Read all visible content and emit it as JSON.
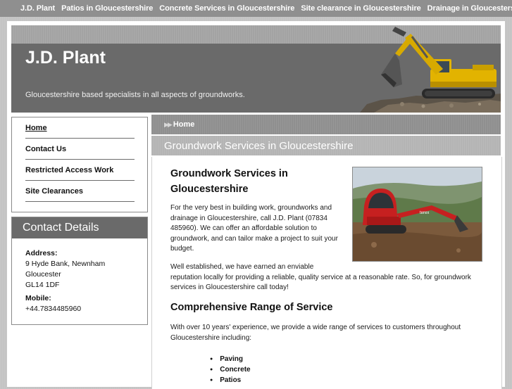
{
  "topnav": {
    "items": [
      "J.D. Plant",
      "Patios in Gloucestershire",
      "Concrete Services in Gloucestershire",
      "Site clearance in Gloucestershire",
      "Drainage in Gloucestershire"
    ]
  },
  "header": {
    "title": "J.D. Plant",
    "tagline": "Gloucestershire based specialists in all aspects of groundworks."
  },
  "sidebar": {
    "items": [
      {
        "label": "Home"
      },
      {
        "label": "Contact Us"
      },
      {
        "label": "Restricted Access Work"
      },
      {
        "label": "Site Clearances"
      }
    ]
  },
  "contact": {
    "heading": "Contact Details",
    "address_label": "Address:",
    "address_lines": [
      "9 Hyde Bank, Newnham",
      "Gloucester",
      "GL14 1DF"
    ],
    "mobile_label": "Mobile:",
    "mobile": "+44.7834485960"
  },
  "breadcrumb": {
    "current": "Home"
  },
  "page": {
    "banner_title": "Groundwork Services in Gloucestershire",
    "heading_line1": "Groundwork Services in",
    "heading_line2": "Gloucestershire",
    "intro_lines": [
      "For the very best in building work, groundworks and",
      "drainage in Gloucestershire, call J.D. Plant (07834",
      "485960). We can offer an affordable solution to",
      "groundwork, and can tailor make a project to suit your",
      "budget."
    ],
    "established_lines": [
      "Well established, we have earned an enviable",
      "reputation locally for providing a reliable, quality service at a reasonable rate. So, for groundwork",
      "services in Gloucestershire call today!"
    ],
    "section_heading": "Comprehensive Range of Service",
    "range_lines": [
      "With over 10 years' experience, we provide a wide range of services to customers throughout",
      "Gloucestershire including:"
    ],
    "services": [
      "Paving",
      "Concrete",
      "Patios"
    ]
  },
  "colors": {
    "header_bg": "#6a6a6a",
    "topnav_bg": "#8f8f8f",
    "page_bg": "#c4c4c4",
    "excavator_yellow": "#e2b300",
    "minidigger_red": "#c62020"
  }
}
